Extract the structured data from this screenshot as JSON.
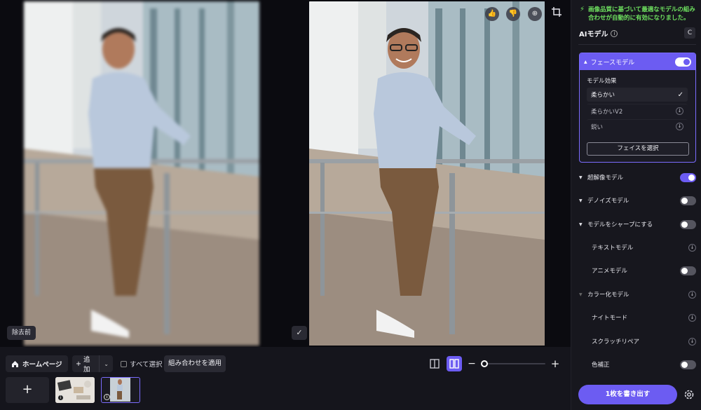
{
  "preview": {
    "before_label": "除去前",
    "after_actions": [
      "thumbs-up-icon",
      "thumbs-down-icon",
      "zoom-in-icon"
    ]
  },
  "toolbar": {
    "home_label": "ホームページ",
    "add_label": "追加",
    "select_all_label": "すべて選択",
    "apply_label": "組み合わせを適用",
    "zoom_minus": "−",
    "zoom_plus": "+",
    "zoom_level": 0.0
  },
  "thumbnails": {
    "add_label": "+",
    "items": [
      {
        "selected": false
      },
      {
        "selected": true
      }
    ]
  },
  "panel": {
    "notice": "画像品質に基づいて最適なモデルの組み合わせが自動的に有効になりました。",
    "ai_title": "AIモデル",
    "reset_label": "C",
    "face": {
      "title": "フェースモデル",
      "enabled": true,
      "effect_label": "モデル効果",
      "options": [
        {
          "label": "柔らかい",
          "state": "selected"
        },
        {
          "label": "柔らかいV2",
          "state": "download"
        },
        {
          "label": "鋭い",
          "state": "download"
        }
      ],
      "select_button": "フェイスを選択"
    },
    "models": [
      {
        "label": "超解像モデル",
        "expand": true,
        "control": "toggle",
        "on": true
      },
      {
        "label": "デノイズモデル",
        "expand": true,
        "control": "toggle",
        "on": false
      },
      {
        "label": "モデルをシャープにする",
        "expand": true,
        "control": "toggle",
        "on": false
      },
      {
        "label": "テキストモデル",
        "expand": false,
        "control": "download"
      },
      {
        "label": "アニメモデル",
        "expand": false,
        "control": "toggle",
        "on": false
      },
      {
        "label": "カラー化モデル",
        "expand": true,
        "control": "download",
        "dim": true
      },
      {
        "label": "ナイトモード",
        "expand": false,
        "control": "download"
      },
      {
        "label": "スクラッチリペア",
        "expand": false,
        "control": "download"
      },
      {
        "label": "色補正",
        "expand": false,
        "control": "toggle",
        "on": false
      }
    ],
    "export_label": "1枚を書き出す"
  },
  "colors": {
    "accent": "#6c5cf2",
    "notice": "#6ee05f",
    "panel_bg": "#17171e"
  }
}
